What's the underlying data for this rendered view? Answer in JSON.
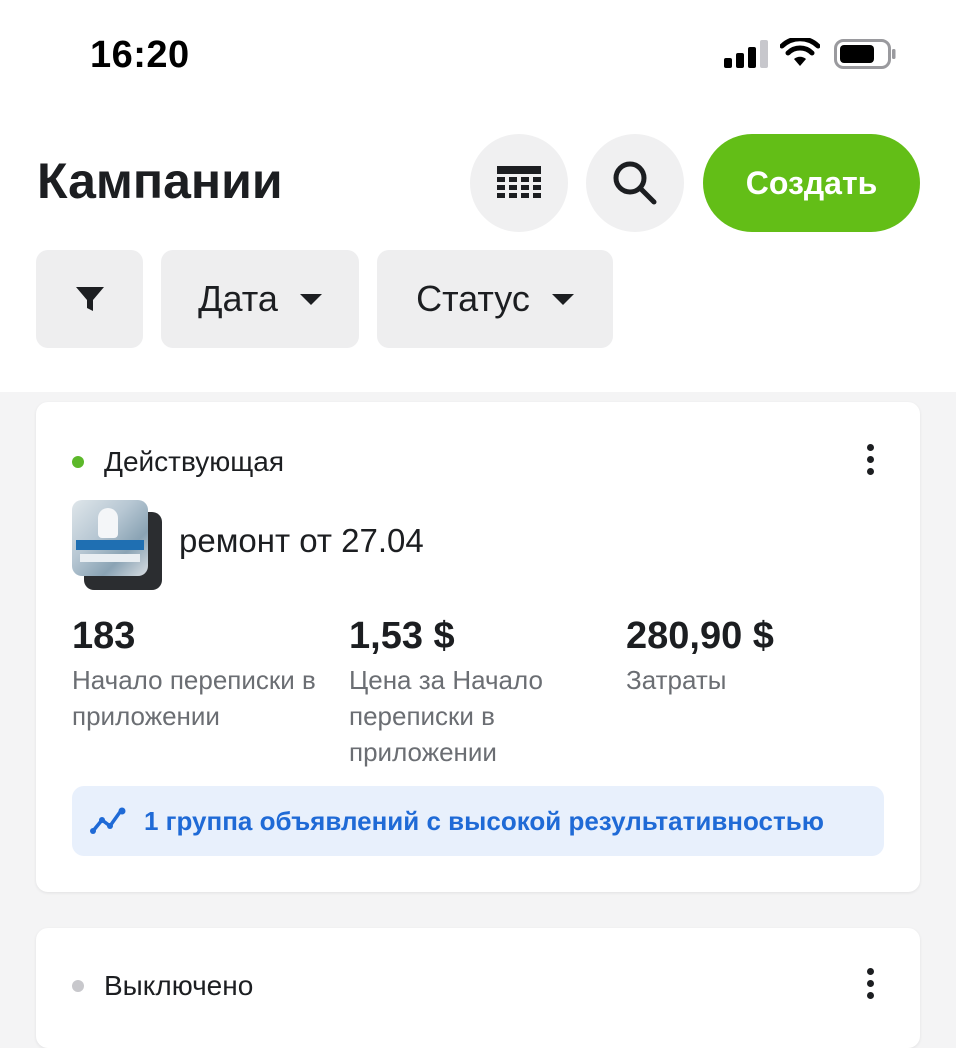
{
  "status_bar": {
    "time": "16:20"
  },
  "header": {
    "title": "Кампании",
    "table_icon": "table-icon",
    "search_icon": "search-icon",
    "create_label": "Создать",
    "accent_color": "#63be17"
  },
  "filters": {
    "filter_icon": "filter-icon",
    "date_label": "Дата",
    "status_label": "Статус"
  },
  "campaigns": [
    {
      "status": "Действующая",
      "status_color": "#5cb82a",
      "name": "ремонт от 27.04",
      "metrics": [
        {
          "value": "183",
          "label": "Начало переписки в приложении"
        },
        {
          "value": "1,53 $",
          "label": "Цена за Начало переписки в приложении"
        },
        {
          "value": "280,90 $",
          "label": "Затраты"
        }
      ],
      "highlight": "1 группа объявлений с высокой результативностью",
      "highlight_color": "#1f6ad6"
    },
    {
      "status": "Выключено",
      "status_color": "#c8c8cc"
    }
  ]
}
